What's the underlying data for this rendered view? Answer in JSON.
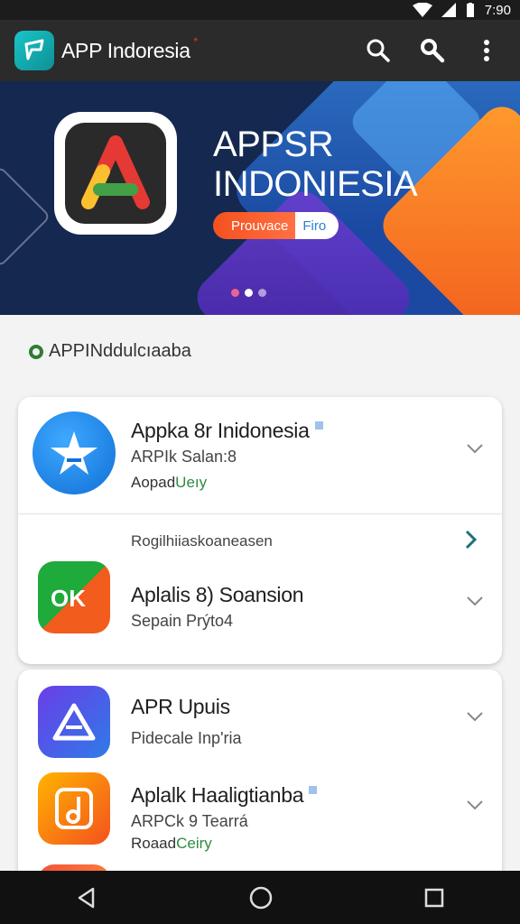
{
  "status": {
    "time": "7:90"
  },
  "app_bar": {
    "title": "APP Indoresia",
    "title_mark": "*",
    "icons": [
      "search-icon",
      "search-icon",
      "more-vert-icon"
    ]
  },
  "banner": {
    "title_line1": "APPSR",
    "title_line2": "INDONIESIA",
    "pill_left": "Prouvace",
    "pill_right": "Firo",
    "page_count": 3,
    "active_page": 2
  },
  "section": {
    "heading": "APPINddulcıaaba"
  },
  "apps": [
    {
      "title": "Appka 8r Inidonesia",
      "subtitle": "ARPIk Salan:8",
      "tag": "Aopad",
      "tag_highlight": "Ueıy",
      "icon": "star-app-icon"
    },
    {
      "title": "Aplalis 8) Soansion",
      "subtitle": "Sepain Prýto4",
      "icon": "ok-app-icon"
    },
    {
      "title": "APR Upuis",
      "subtitle": "Pidecale Inp'ria",
      "icon": "triangle-app-icon"
    },
    {
      "title": "Aplalk Haaligtianba",
      "subtitle": "ARPCk 9 Tearrá",
      "tag": "Roaad",
      "tag_highlight": "Ceiry",
      "icon": "music-app-icon"
    }
  ],
  "card_subheading": "Rogilhiiaskoaneasen",
  "colors": {
    "accent_green": "#2e8b3e",
    "banner_bg": "#142850",
    "app_bar": "#2b2b2b"
  }
}
